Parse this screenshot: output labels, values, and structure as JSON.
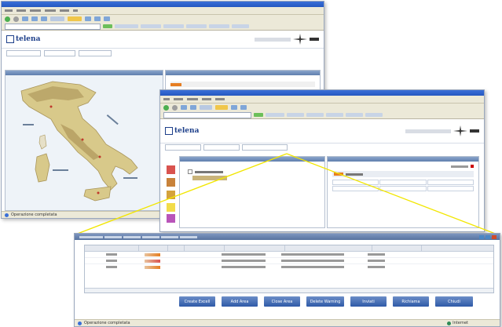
{
  "window1": {
    "logo": "telena",
    "status": "Operazione completata"
  },
  "window2": {
    "logo": "telena"
  },
  "window3": {
    "buttons": [
      "Create Excell",
      "Add Area",
      "Close Area",
      "Delete Warning",
      "Inviati",
      "Richiama",
      "Chiudi"
    ],
    "status": "Operazione completata",
    "status_right": "Internet"
  },
  "colors": {
    "titlebar": "#2457c0",
    "panel_header": "#5f7fae",
    "callout_line": "#f2e600",
    "map_land": "#d8c98a",
    "map_sea": "#eef3f8"
  },
  "icons": [
    "back-icon",
    "forward-icon",
    "search-icon",
    "favorites-icon",
    "globe-icon",
    "close-icon",
    "minimize-icon",
    "maximize-icon"
  ]
}
